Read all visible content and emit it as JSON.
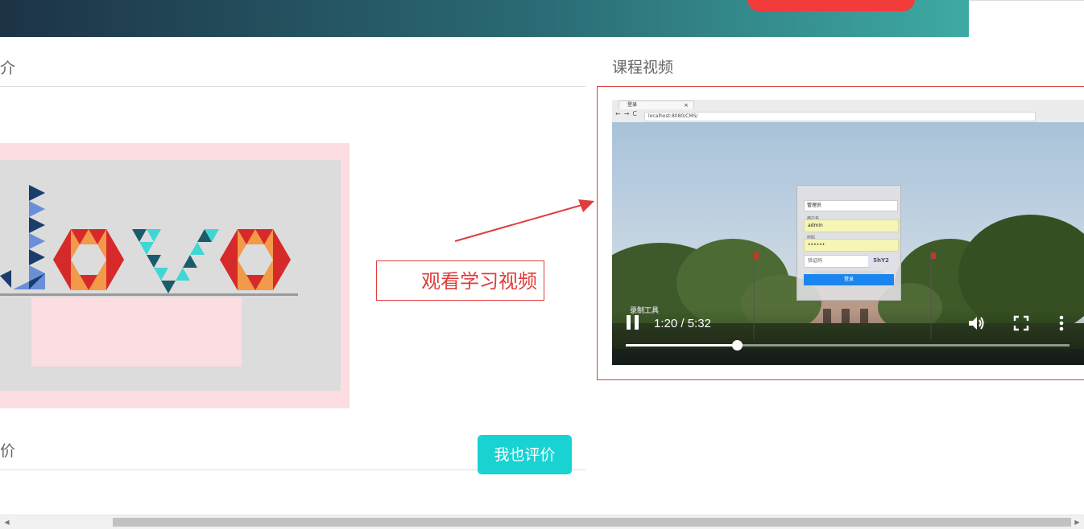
{
  "sections": {
    "intro_title": "介",
    "video_title": "课程视频",
    "rating_title": "价"
  },
  "annotation": {
    "label": "观看学习视频"
  },
  "rating": {
    "button_label": "我也评价"
  },
  "video": {
    "browser_tab_title": "登录",
    "browser_url": "localhost:8080/CMS/",
    "login": {
      "role_value": "管理员",
      "username_label": "用户名",
      "username_value": "admin",
      "password_label": "密码",
      "password_value": "••••••",
      "captcha_placeholder": "验证码",
      "captcha_text": "5hY2",
      "submit_label": "登录"
    },
    "watermark": "录制工具",
    "time_display": "1:20 / 5:32",
    "progress": 0.25,
    "icons": [
      "pause-icon",
      "volume-icon",
      "fullscreen-icon",
      "more-vertical-icon"
    ]
  },
  "colors": {
    "accent_teal": "#19d3d3",
    "annotation_red": "#e03c3c",
    "banner_button_red": "#f23b3b"
  }
}
